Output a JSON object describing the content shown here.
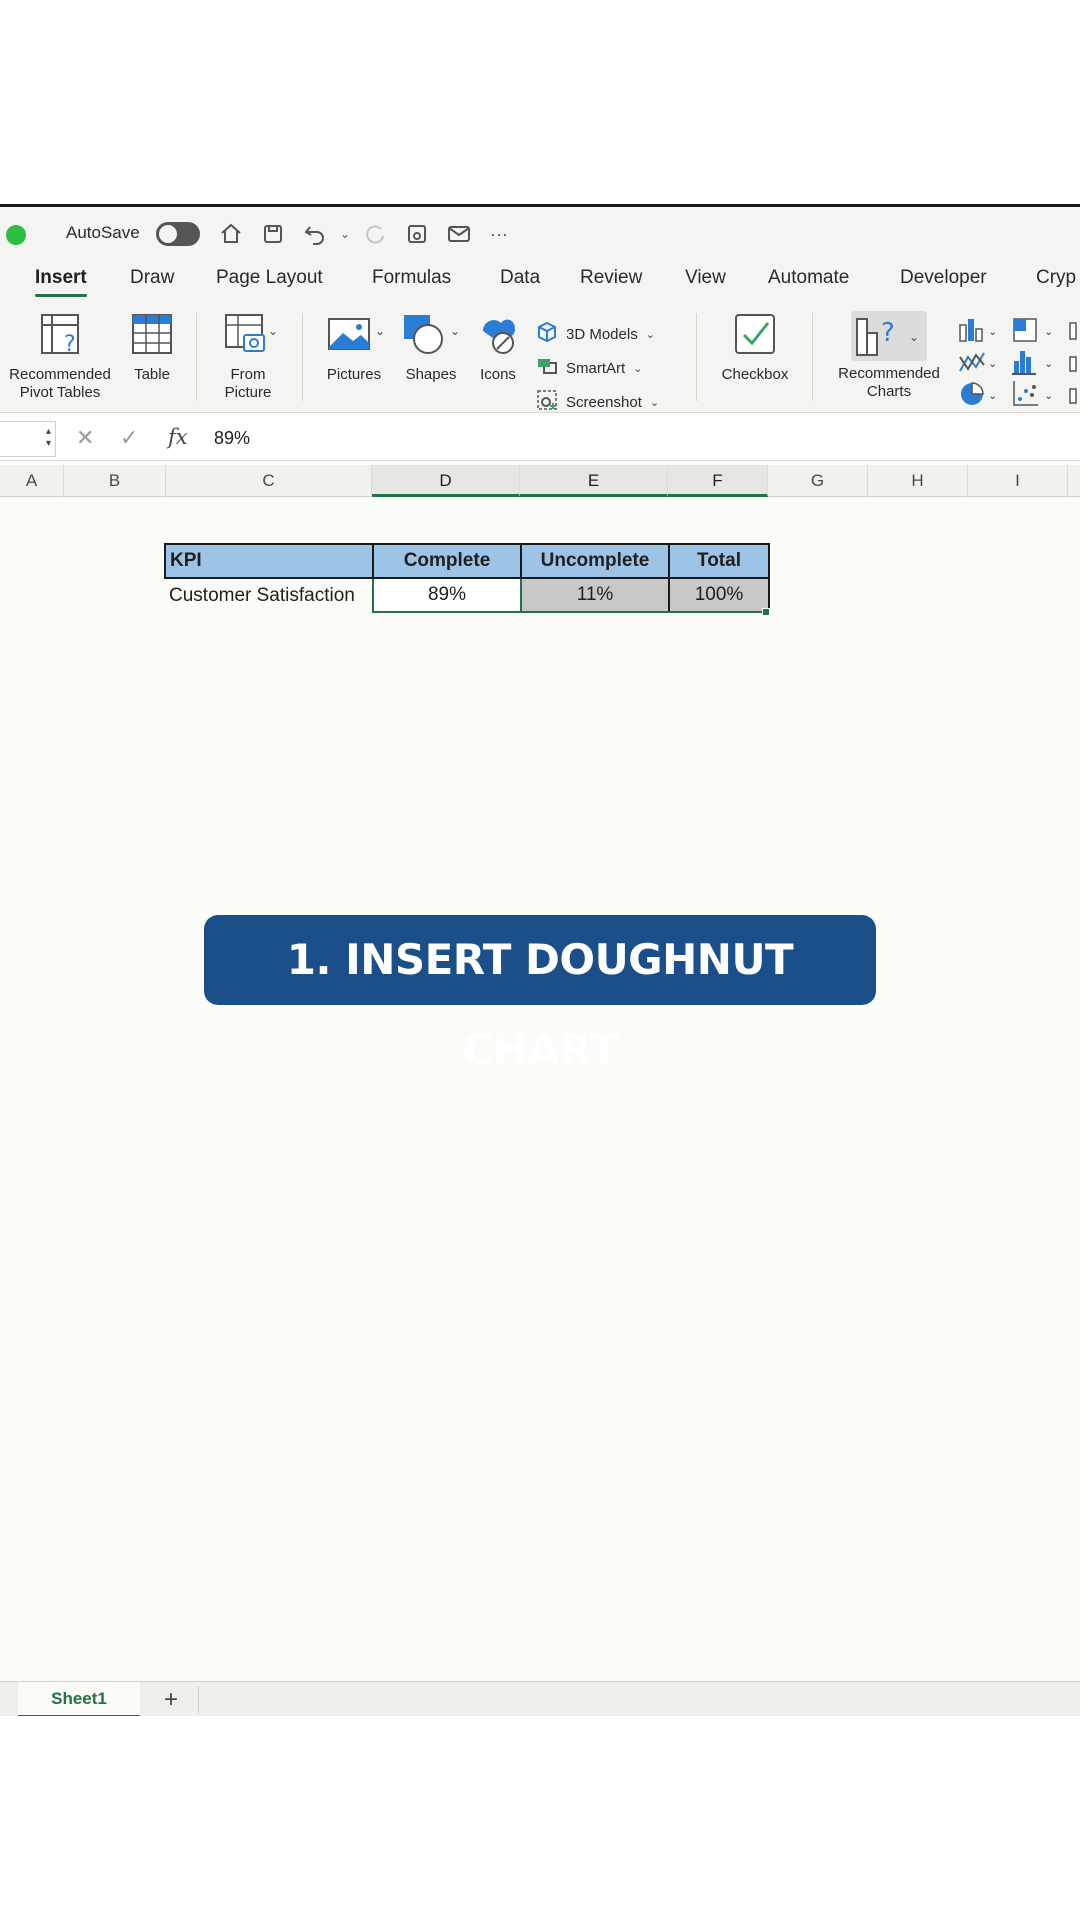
{
  "titlebar": {
    "autosave_label": "AutoSave",
    "more_label": "···"
  },
  "tabs": [
    "Insert",
    "Draw",
    "Page Layout",
    "Formulas",
    "Data",
    "Review",
    "View",
    "Automate",
    "Developer",
    "Cryp"
  ],
  "ribbon": {
    "recommended_pivot_line1": "Recommended",
    "recommended_pivot_line2": "Pivot Tables",
    "table": "Table",
    "from_picture_line1": "From",
    "from_picture_line2": "Picture",
    "pictures": "Pictures",
    "shapes": "Shapes",
    "icons": "Icons",
    "models_3d": "3D Models",
    "smartart": "SmartArt",
    "screenshot": "Screenshot",
    "checkbox": "Checkbox",
    "recommended_charts_line1": "Recommended",
    "recommended_charts_line2": "Charts"
  },
  "formula_bar": {
    "fx_label": "fx",
    "value": "89%"
  },
  "columns": [
    "A",
    "B",
    "C",
    "D",
    "E",
    "F",
    "G",
    "H",
    "I"
  ],
  "kpi_table": {
    "headers": [
      "KPI",
      "Complete",
      "Uncomplete",
      "Total"
    ],
    "row": [
      "Customer Satisfaction",
      "89%",
      "11%",
      "100%"
    ]
  },
  "caption": "1. INSERT DOUGHNUT CHART",
  "sheets": {
    "active": "Sheet1",
    "add_label": "+"
  },
  "colors": {
    "excel_green": "#217346",
    "header_blue": "#9dc3e6",
    "caption_blue": "#1b4f8a",
    "grey_cell": "#c8c8c8"
  }
}
